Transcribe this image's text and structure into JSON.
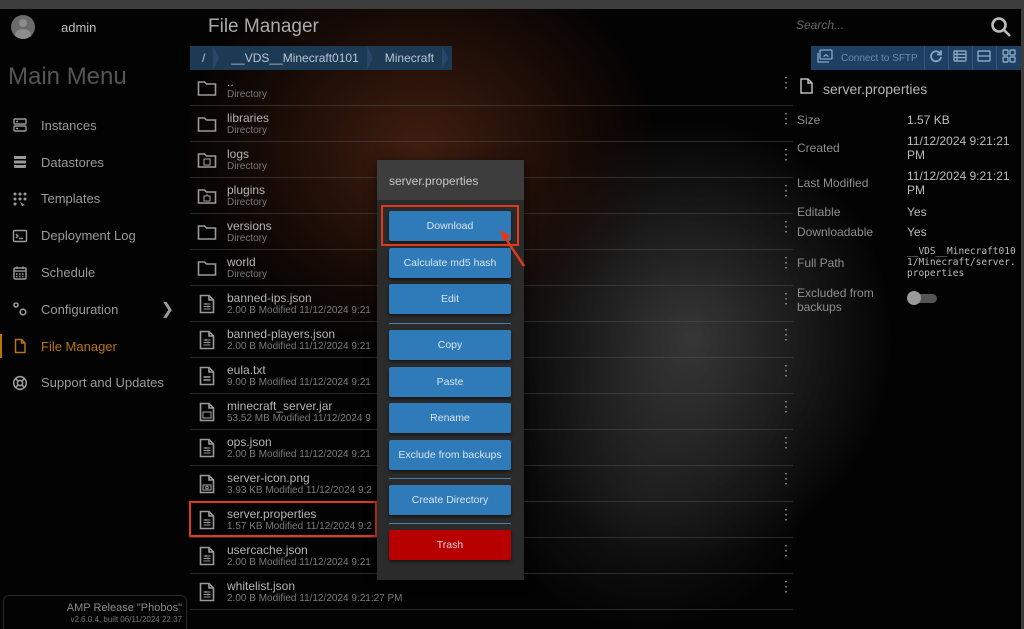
{
  "user": {
    "name": "admin"
  },
  "sidebar": {
    "title": "Main Menu",
    "items": [
      {
        "label": "Instances",
        "icon": "server-icon",
        "active": false
      },
      {
        "label": "Datastores",
        "icon": "database-icon",
        "active": false
      },
      {
        "label": "Templates",
        "icon": "templates-grid-icon",
        "active": false
      },
      {
        "label": "Deployment Log",
        "icon": "terminal-icon",
        "active": false
      },
      {
        "label": "Schedule",
        "icon": "calendar-icon",
        "active": false
      },
      {
        "label": "Configuration",
        "icon": "gears-icon",
        "active": false,
        "has_submenu": true
      },
      {
        "label": "File Manager",
        "icon": "file-icon",
        "active": true
      },
      {
        "label": "Support and Updates",
        "icon": "lifebuoy-icon",
        "active": false
      }
    ],
    "release": {
      "name": "AMP Release \"Phobos\"",
      "version": "v2.6.0.4, built 06/11/2024 22:37"
    }
  },
  "file_manager": {
    "title": "File Manager",
    "breadcrumb": [
      "/",
      "__VDS__Minecraft0101",
      "Minecraft"
    ],
    "files": [
      {
        "name": "..",
        "sub": "Directory",
        "icon": "folder-icon"
      },
      {
        "name": "libraries",
        "sub": "Directory",
        "icon": "folder-icon"
      },
      {
        "name": "logs",
        "sub": "Directory",
        "icon": "folder-document-icon"
      },
      {
        "name": "plugins",
        "sub": "Directory",
        "icon": "folder-puzzle-icon"
      },
      {
        "name": "versions",
        "sub": "Directory",
        "icon": "folder-icon"
      },
      {
        "name": "world",
        "sub": "Directory",
        "icon": "folder-icon"
      },
      {
        "name": "banned-ips.json",
        "sub": "2.00 B Modified 11/12/2024 9:21",
        "icon": "settings-file-icon"
      },
      {
        "name": "banned-players.json",
        "sub": "2.00 B Modified 11/12/2024 9:21",
        "icon": "settings-file-icon"
      },
      {
        "name": "eula.txt",
        "sub": "9.00 B Modified 11/12/2024 9:21",
        "icon": "text-file-icon"
      },
      {
        "name": "minecraft_server.jar",
        "sub": "53.52 MB Modified 11/12/2024 9",
        "icon": "executable-file-icon"
      },
      {
        "name": "ops.json",
        "sub": "2.00 B Modified 11/12/2024 9:21",
        "icon": "settings-file-icon"
      },
      {
        "name": "server-icon.png",
        "sub": "3.93 KB Modified 11/12/2024 9:2",
        "icon": "image-file-icon"
      },
      {
        "name": "server.properties",
        "sub": "1.57 KB Modified 11/12/2024 9:2",
        "icon": "settings-file-icon"
      },
      {
        "name": "usercache.json",
        "sub": "2.00 B Modified 11/12/2024 9:21",
        "icon": "settings-file-icon"
      },
      {
        "name": "whitelist.json",
        "sub": "2.00 B Modified 11/12/2024 9:21:27 PM",
        "icon": "settings-file-icon"
      }
    ]
  },
  "context_menu": {
    "title": "server.properties",
    "buttons": [
      {
        "label": "Download"
      },
      {
        "label": "Calculate md5 hash"
      },
      {
        "label": "Edit"
      },
      {
        "label": "Copy"
      },
      {
        "label": "Paste"
      },
      {
        "label": "Rename"
      },
      {
        "label": "Exclude from backups"
      },
      {
        "label": "Create Directory"
      },
      {
        "label": "Trash",
        "danger": true
      }
    ]
  },
  "search": {
    "placeholder": "Search..."
  },
  "toolbar": {
    "sftp_label": "Connect to SFTP"
  },
  "properties": {
    "title": "server.properties",
    "rows": [
      {
        "key": "Size",
        "value": "1.57 KB"
      },
      {
        "key": "Created",
        "value": "11/12/2024 9:21:21 PM"
      },
      {
        "key": "Last Modified",
        "value": "11/12/2024 9:21:21 PM"
      },
      {
        "key": "Editable",
        "value": "Yes"
      },
      {
        "key": "Downloadable",
        "value": "Yes"
      },
      {
        "key": "Full Path",
        "value": "__VDS__Minecraft0101/Minecraft/server.properties"
      },
      {
        "key": "Excluded from backups",
        "value": "off"
      }
    ]
  },
  "colors": {
    "accent": "#b8740f",
    "button_blue": "#2f7ab8",
    "danger": "#b80000",
    "annotation_red": "#e03a1c",
    "breadcrumb_bg": "#1d3a55"
  }
}
